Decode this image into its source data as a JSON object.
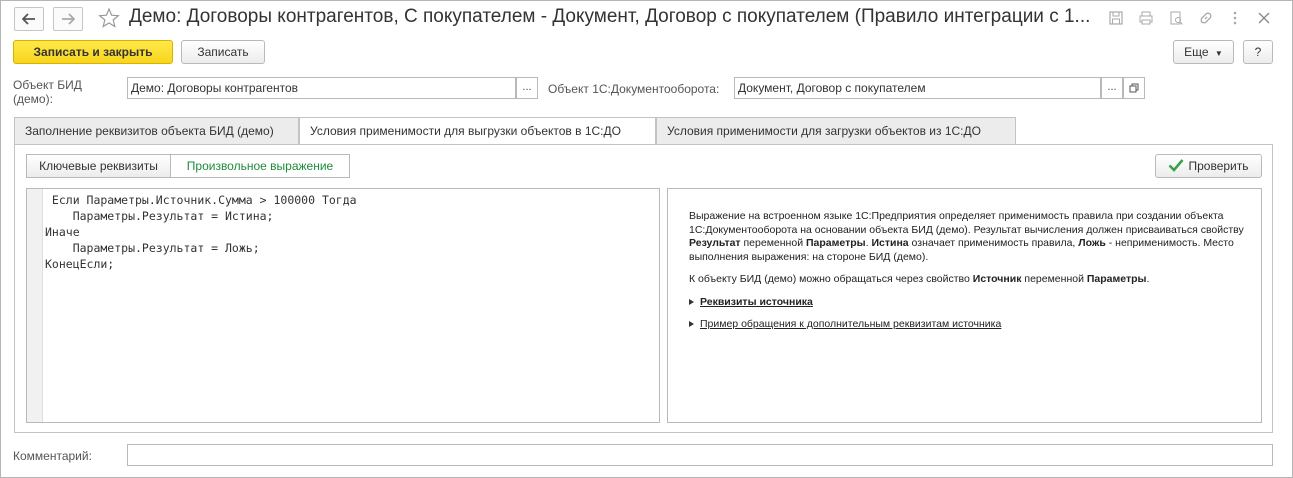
{
  "window": {
    "title": "Демо: Договоры контрагентов, С покупателем - Документ, Договор с покупателем (Правило интеграции с 1..."
  },
  "toolbar": {
    "save_close_label": "Записать и закрыть",
    "save_label": "Записать",
    "more_label": "Еще",
    "help_label": "?"
  },
  "form": {
    "bid_object_label": "Объект БИД (демо):",
    "bid_object_value": "Демо: Договоры контрагентов",
    "do_object_label": "Объект 1С:Документооборота:",
    "do_object_value": "Документ, Договор с покупателем",
    "select_button": "...",
    "comment_label": "Комментарий:",
    "comment_value": ""
  },
  "tabs": [
    {
      "label": "Заполнение реквизитов объекта БИД (демо)",
      "active": false
    },
    {
      "label": "Условия применимости для выгрузки объектов в 1С:ДО",
      "active": true
    },
    {
      "label": "Условия применимости для загрузки объектов из 1С:ДО",
      "active": false
    }
  ],
  "mode_switch": {
    "key_fields": "Ключевые реквизиты",
    "custom_expr": "Произвольное выражение",
    "selected": "custom_expr"
  },
  "check_button": "Проверить",
  "code_lines": [
    " Если Параметры.Источник.Сумма > 100000 Тогда",
    "    Параметры.Результат = Истина;",
    "Иначе",
    "    Параметры.Результат = Ложь;",
    "КонецЕсли;"
  ],
  "help": {
    "p1_a": "Выражение на встроенном языке 1С:Предприятия определяет применимость правила при создании объекта 1С:Документооборота на основании объекта БИД (демо). Результат вычисления должен присваиваться свойству ",
    "p1_b": "Результат",
    "p1_c": " переменной ",
    "p1_d": "Параметры",
    "p1_e": ". ",
    "p1_f": "Истина",
    "p1_g": " означает применимость правила, ",
    "p1_h": "Ложь",
    "p1_i": " - неприменимость. Место выполнения выражения: на стороне БИД (демо).",
    "p2_a": "К объекту БИД (демо) можно обращаться через свойство ",
    "p2_b": "Источник",
    "p2_c": " переменной ",
    "p2_d": "Параметры",
    "p2_e": ".",
    "link1": "Реквизиты источника",
    "link2": "Пример обращения к дополнительным реквизитам источника"
  },
  "colors": {
    "primary_button": "#f8d51e",
    "selected_option": "#1c8c3a",
    "check_icon": "#3aa04a"
  }
}
